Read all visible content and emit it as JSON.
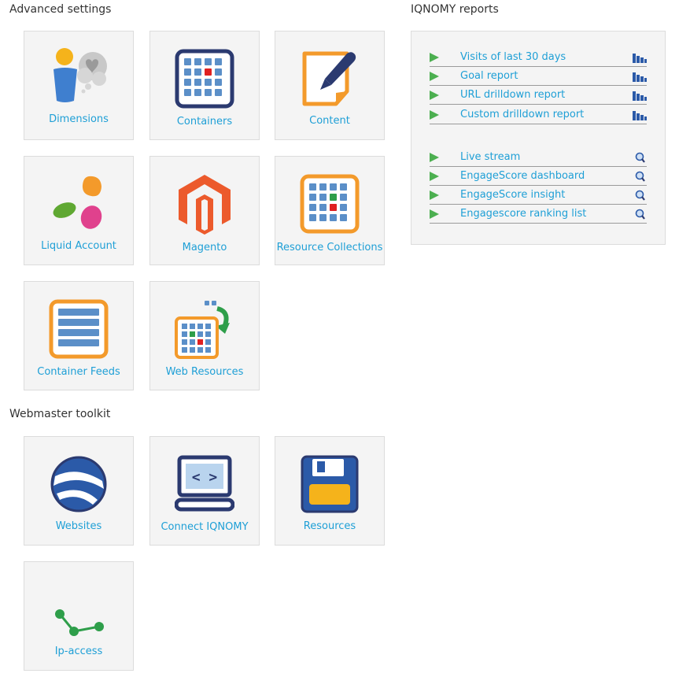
{
  "advanced_settings": {
    "title": "Advanced settings",
    "tiles": [
      {
        "label": "Dimensions",
        "icon": "dimensions-icon"
      },
      {
        "label": "Containers",
        "icon": "containers-icon"
      },
      {
        "label": "Content",
        "icon": "content-icon"
      },
      {
        "label": "Liquid Account",
        "icon": "liquid-account-icon"
      },
      {
        "label": "Magento",
        "icon": "magento-icon"
      },
      {
        "label": "Resource Collections",
        "icon": "resource-collections-icon"
      },
      {
        "label": "Container Feeds",
        "icon": "container-feeds-icon"
      },
      {
        "label": "Web Resources",
        "icon": "web-resources-icon"
      }
    ]
  },
  "webmaster_toolkit": {
    "title": "Webmaster toolkit",
    "tiles": [
      {
        "label": "Websites",
        "icon": "websites-icon"
      },
      {
        "label": "Connect IQNOMY",
        "icon": "connect-iqnomy-icon"
      },
      {
        "label": "Resources",
        "icon": "resources-icon"
      },
      {
        "label": "Ip-access",
        "icon": "ip-access-icon"
      }
    ]
  },
  "reports": {
    "title": "IQNOMY reports",
    "group1": [
      {
        "label": "Visits of last 30 days",
        "icon": "bar-chart-icon"
      },
      {
        "label": "Goal report",
        "icon": "bar-chart-icon"
      },
      {
        "label": "URL drilldown report",
        "icon": "bar-chart-icon"
      },
      {
        "label": "Custom drilldown report",
        "icon": "bar-chart-icon"
      }
    ],
    "group2": [
      {
        "label": "Live stream",
        "icon": "magnifier-icon"
      },
      {
        "label": "EngageScore dashboard",
        "icon": "magnifier-icon"
      },
      {
        "label": "EngageScore insight",
        "icon": "magnifier-icon"
      },
      {
        "label": "Engagescore ranking list",
        "icon": "magnifier-icon"
      }
    ]
  },
  "colors": {
    "link": "#1e9fd6",
    "tile_bg": "#f4f4f4",
    "play_green": "#4caf50",
    "navy": "#2b3a70",
    "orange": "#f39a2b"
  }
}
